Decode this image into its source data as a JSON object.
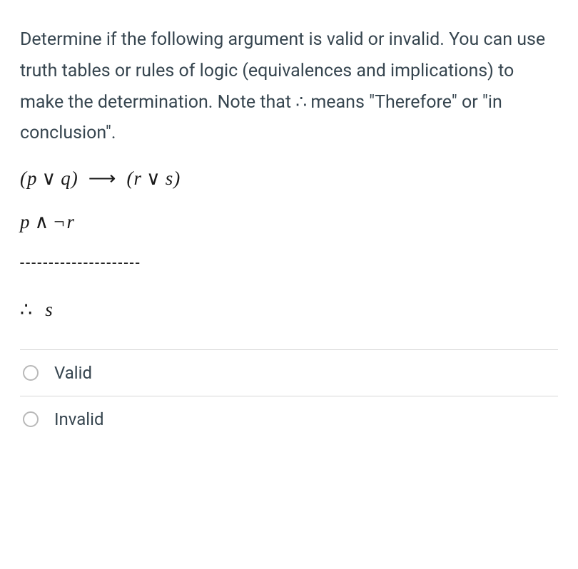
{
  "question": {
    "text_part1": "Determine if the following argument is valid or invalid. You can use truth tables or rules of logic (equivalences and implications) to make the determination. Note that ",
    "therefore_symbol": "∴",
    "text_part2": " means \"Therefore\" or \"in conclusion\"."
  },
  "argument": {
    "premise1": {
      "lhs_open": "(",
      "lhs_p": "p",
      "lhs_or": "∨",
      "lhs_q": "q",
      "lhs_close": ")",
      "arrow": "⟶",
      "rhs_open": "(",
      "rhs_r": "r",
      "rhs_or": "∨",
      "rhs_s": "s",
      "rhs_close": ")"
    },
    "premise2": {
      "p": "p",
      "and": "∧",
      "not": "¬",
      "r": "r"
    },
    "separator": "---------------------",
    "conclusion": {
      "therefore": "∴",
      "s": "s"
    }
  },
  "options": [
    {
      "label": "Valid"
    },
    {
      "label": "Invalid"
    }
  ]
}
